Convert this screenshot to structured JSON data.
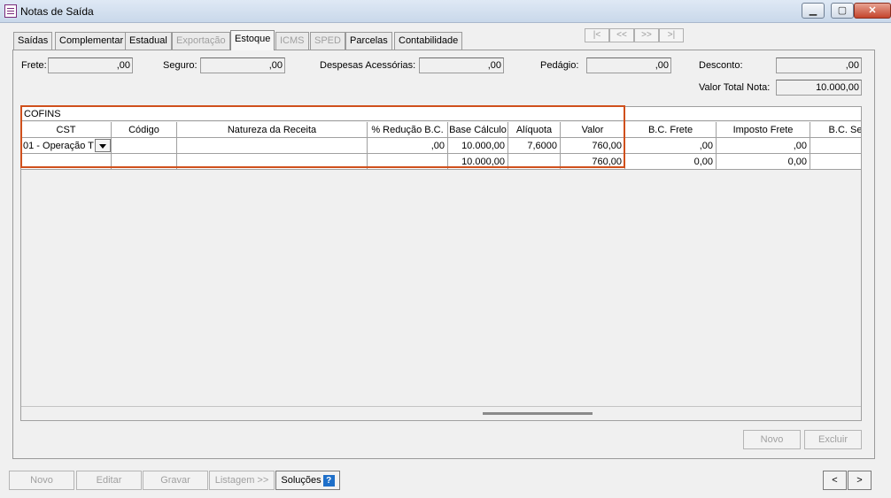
{
  "window": {
    "title": "Notas de Saída",
    "min": "▁",
    "max": "▢",
    "close": "✕"
  },
  "tabs": [
    {
      "label": "Saídas"
    },
    {
      "label": "Complementar"
    },
    {
      "label": "Estadual"
    },
    {
      "label": "Exportação"
    },
    {
      "label": "Estoque"
    },
    {
      "label": "ICMS"
    },
    {
      "label": "SPED"
    },
    {
      "label": "Parcelas"
    },
    {
      "label": "Contabilidade"
    }
  ],
  "record_nav": {
    "first": "|<",
    "prev": "<<",
    "next": ">>",
    "last": ">|"
  },
  "totals": {
    "frete_label": "Frete:",
    "frete_value": ",00",
    "seguro_label": "Seguro:",
    "seguro_value": ",00",
    "despesas_label": "Despesas Acessórias:",
    "despesas_value": ",00",
    "pedagio_label": "Pedágio:",
    "pedagio_value": ",00",
    "desconto_label": "Desconto:",
    "desconto_value": ",00",
    "valor_total_label": "Valor Total Nota:",
    "valor_total_value": "10.000,00"
  },
  "grid": {
    "title": "COFINS",
    "columns": [
      "CST",
      "Código",
      "Natureza da Receita",
      "% Redução B.C.",
      "Base Cálculo",
      "Alíquota",
      "Valor",
      "B.C. Frete",
      "Imposto Frete",
      "B.C. Se"
    ],
    "row": [
      "01 - Operação T",
      "",
      "",
      ",00",
      "10.000,00",
      "7,6000",
      "760,00",
      ",00",
      ",00",
      ""
    ],
    "total_row": [
      "",
      "",
      "",
      "",
      "10.000,00",
      "",
      "760,00",
      "0,00",
      "0,00",
      ""
    ]
  },
  "panel_buttons": {
    "novo": "Novo",
    "excluir": "Excluir"
  },
  "footer": {
    "novo": "Novo",
    "editar": "Editar",
    "gravar": "Gravar",
    "listagem": "Listagem >>",
    "solucoes": "Soluções",
    "help": "?",
    "prev": "<",
    "next": ">"
  }
}
